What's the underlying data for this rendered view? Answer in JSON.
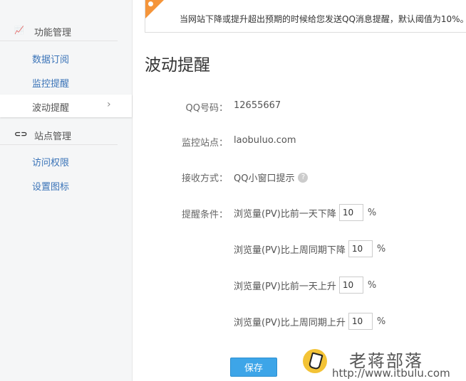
{
  "sidebar": {
    "groups": [
      {
        "label": "功能管理",
        "icon": "chart-icon"
      },
      {
        "label": "站点管理",
        "icon": "link-icon"
      }
    ],
    "items": [
      {
        "label": "数据订阅"
      },
      {
        "label": "监控提醒"
      },
      {
        "label": "波动提醒",
        "active": true
      },
      {
        "label": "访问权限"
      },
      {
        "label": "设置图标"
      }
    ]
  },
  "notice": {
    "text": "当网站下降或提升超出预期的时候给您发送QQ消息提醒，默认阈值为10%。",
    "accent": "#f5953a"
  },
  "main": {
    "title": "波动提醒",
    "qq_label": "QQ号码：",
    "qq_value": "12655667",
    "site_label": "监控站点：",
    "site_value": "laobuluo.com",
    "method_label": "接收方式：",
    "method_value": "QQ小窗口提示",
    "cond_label": "提醒条件：",
    "conditions": [
      {
        "text": "浏览量(PV)比前一天下降",
        "value": "10",
        "unit": "%"
      },
      {
        "text": "浏览量(PV)比上周同期下降",
        "value": "10",
        "unit": "%"
      },
      {
        "text": "浏览量(PV)比前一天上升",
        "value": "10",
        "unit": "%"
      },
      {
        "text": "浏览量(PV)比上周同期上升",
        "value": "10",
        "unit": "%"
      }
    ],
    "save_label": "保存"
  },
  "watermark": {
    "name": "老蒋部落",
    "url": "http://www.itbulu.com"
  }
}
